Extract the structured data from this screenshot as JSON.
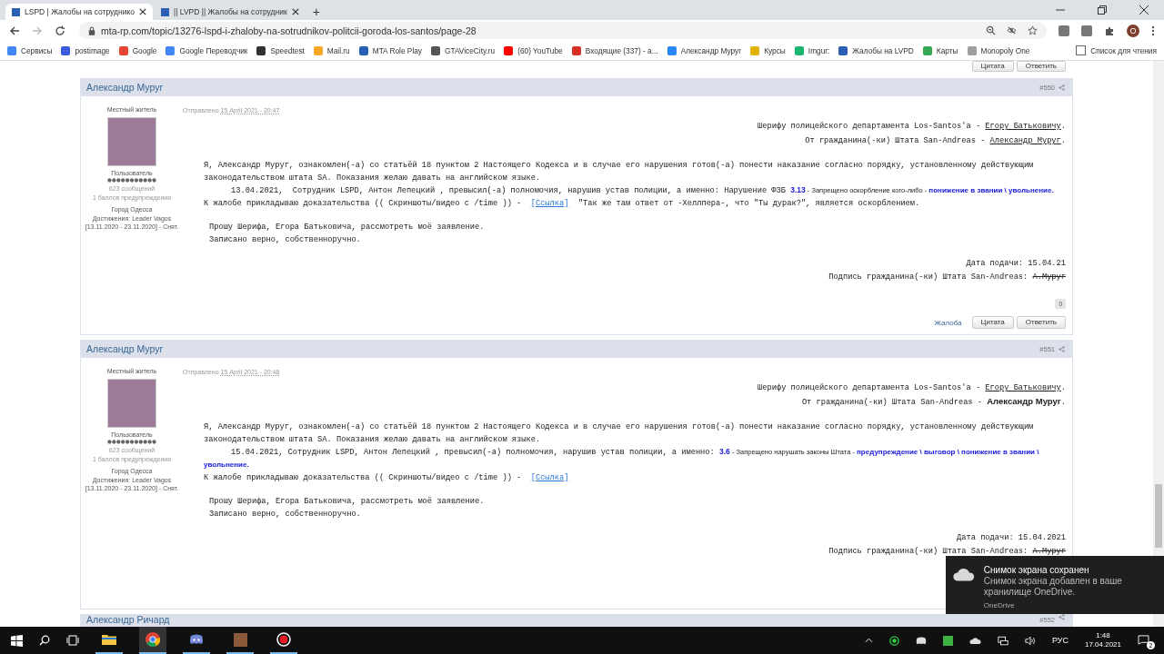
{
  "browser": {
    "tabs": [
      {
        "title": "LSPD | Жалобы на сотруднико",
        "selected": true
      },
      {
        "title": "|| LVPD || Жалобы на сотрудник",
        "selected": false
      }
    ],
    "new_tab": "+",
    "url": "mta-rp.com/topic/13276-lspd-i-zhaloby-na-sotrudnikov-politcii-goroda-los-santos/page-28",
    "profile_letter": "O",
    "bookmarks": [
      {
        "label": "Сервисы",
        "color": "#4285f4"
      },
      {
        "label": "postimage",
        "color": "#3b5bdb"
      },
      {
        "label": "Google",
        "color": "#ea4335"
      },
      {
        "label": "Google Переводчик",
        "color": "#4285f4"
      },
      {
        "label": "Speedtest",
        "color": "#333333"
      },
      {
        "label": "Mail.ru",
        "color": "#f5a623"
      },
      {
        "label": "MTA Role Play",
        "color": "#2b5fb3"
      },
      {
        "label": "GTAViceCity.ru",
        "color": "#555555"
      },
      {
        "label": "(60) YouTube",
        "color": "#ff0000"
      },
      {
        "label": "Входящие (337) - а...",
        "color": "#d93025"
      },
      {
        "label": "Александр Муруг",
        "color": "#2787f5"
      },
      {
        "label": "Курсы",
        "color": "#e0b400"
      },
      {
        "label": "Imgur:",
        "color": "#1bb76e"
      },
      {
        "label": "Жалобы на LVPD",
        "color": "#2b5fb3"
      },
      {
        "label": "Карты",
        "color": "#34a853"
      },
      {
        "label": "Monopoly One",
        "color": "#9e9e9e"
      }
    ],
    "reading_list": "Список для чтения"
  },
  "previous_post_actions": {
    "quote": "Цитата",
    "reply": "Ответить"
  },
  "posts": [
    {
      "author": "Александр Муруг",
      "number": "#550",
      "title": "Местный житель",
      "group": "Пользователь",
      "posts_count": "623 сообщений",
      "warnings": "1 баллов предупреждения",
      "city": "Город Одесса",
      "achievements": "Достижения: Leader Vagos [13.11.2020 - 23.11.2020] - Снят.",
      "posted": {
        "label": "Отправлено",
        "date": "15 April 2021 - 20:47"
      },
      "address": [
        [
          {
            "kind": "plain",
            "text": "Шерифу полицейского департамента Los-Santos'a - "
          },
          {
            "kind": "underline",
            "text": "Егору Батьковичу"
          },
          {
            "kind": "plain",
            "text": "."
          }
        ],
        [
          {
            "kind": "plain",
            "text": "От гражданина(-ки) Штата San-Andreas - "
          },
          {
            "kind": "underline",
            "text": "Александр Муруг"
          },
          {
            "kind": "plain",
            "text": "."
          }
        ]
      ],
      "statement": [
        {
          "indent": false,
          "segments": [
            {
              "kind": "plain",
              "text": "Я, Александр Муруг, ознакомлен(-а) со статьёй 18 пунктом 2 Настоящего Кодекса и в случае его нарушения готов(-а) понести наказание согласно порядку, установленному действующим законодательством штата SA. Показания желаю давать на английском языке."
            }
          ]
        },
        {
          "indent": true,
          "segments": [
            {
              "kind": "plain",
              "text": "13.04.2021,  Сотрудник LSPD, Антон Лепецкий , превысил(-а) полномочия, нарушив устав полиции, а именно: Нарушение ФЗБ "
            },
            {
              "kind": "code",
              "text": "3.13"
            },
            {
              "kind": "note",
              "text": " - Запрещено оскорбление кого-либо - "
            },
            {
              "kind": "penalty",
              "text": "понижение в звании \\ увольнение."
            }
          ]
        },
        {
          "indent": false,
          "segments": [
            {
              "kind": "plain",
              "text": "К жалобе прикладываю доказательства (( Скриншоты/видео с /time )) -  "
            },
            {
              "kind": "link",
              "text": "[Ссылка]"
            },
            {
              "kind": "plain",
              "text": "  \"Так же там ответ от -Хеллпера-, что \"Ты дурак?\", является оскорблением."
            }
          ]
        }
      ],
      "request": [
        "Прошу Шерифа, Егора Батьковича, рассмотреть моё заявление.",
        "Записано верно, собственноручно."
      ],
      "signature": [
        [
          {
            "kind": "plain",
            "text": "Дата подачи: 15.04.21"
          }
        ],
        [
          {
            "kind": "plain",
            "text": "Подпись гражданина(-ки) Штата San-Andreas: "
          },
          {
            "kind": "strike",
            "text": "А.Муруг"
          }
        ]
      ],
      "reputation": "0",
      "actions": {
        "report": "Жалоба",
        "quote": "Цитата",
        "reply": "Ответить"
      }
    },
    {
      "author": "Александр Муруг",
      "number": "#551",
      "title": "Местный житель",
      "group": "Пользователь",
      "posts_count": "623 сообщений",
      "warnings": "1 баллов предупреждения",
      "city": "Город Одесса",
      "achievements": "Достижения: Leader Vagos [13.11.2020 - 23.11.2020] - Снят.",
      "posted": {
        "label": "Отправлено",
        "date": "15 April 2021 - 20:48"
      },
      "address": [
        [
          {
            "kind": "plain",
            "text": "Шерифу полицейского департамента Los-Santos'a - "
          },
          {
            "kind": "underline",
            "text": "Егору Батьковичу"
          },
          {
            "kind": "plain",
            "text": "."
          }
        ],
        [
          {
            "kind": "plain",
            "text": "От гражданина(-ки) Штата San-Andreas - "
          },
          {
            "kind": "name",
            "text": "Александр Муруг"
          },
          {
            "kind": "plain",
            "text": "."
          }
        ]
      ],
      "statement": [
        {
          "indent": false,
          "segments": [
            {
              "kind": "plain",
              "text": "Я, Александр Муруг, ознакомлен(-а) со статьёй 18 пунктом 2 Настоящего Кодекса и в случае его нарушения готов(-а) понести наказание согласно порядку, установленному действующим законодательством штата SA. Показания желаю давать на английском языке."
            }
          ]
        },
        {
          "indent": true,
          "segments": [
            {
              "kind": "plain",
              "text": "15.04.2021, Сотрудник LSPD, Антон Лепецкий , превысил(-а) полномочия, нарушив устав полиции, а именно: "
            },
            {
              "kind": "code",
              "text": "3.6"
            },
            {
              "kind": "note",
              "text": " - Запрещено нарушать законы Штата - "
            },
            {
              "kind": "penalty",
              "text": "предупреждение \\ выговор \\ понижение в звании \\ увольнение."
            }
          ]
        },
        {
          "indent": false,
          "segments": [
            {
              "kind": "plain",
              "text": "К жалобе прикладываю доказательства (( Скриншоты/видео с /time )) -  "
            },
            {
              "kind": "link",
              "text": "[Ссылка]"
            }
          ]
        }
      ],
      "request": [
        "Прошу Шерифа, Егора Батьковича, рассмотреть моё заявление.",
        "Записано верно, собственноручно."
      ],
      "signature": [
        [
          {
            "kind": "plain",
            "text": "Дата подачи: 15.04.2021"
          }
        ],
        [
          {
            "kind": "plain",
            "text": "Подпись гражданина(-ки) Штата San-Andreas: "
          },
          {
            "kind": "strike",
            "text": "А.Муруг"
          }
        ]
      ]
    }
  ],
  "next_post": {
    "author": "Александр Ричард",
    "number": "#552"
  },
  "toast": {
    "title": "Снимок экрана сохранен",
    "body": "Снимок экрана добавлен в ваше хранилище OneDrive.",
    "source": "OneDrive"
  },
  "taskbar": {
    "language": "РУС",
    "time": "1:48",
    "date": "17.04.2021",
    "notifications": "2"
  }
}
